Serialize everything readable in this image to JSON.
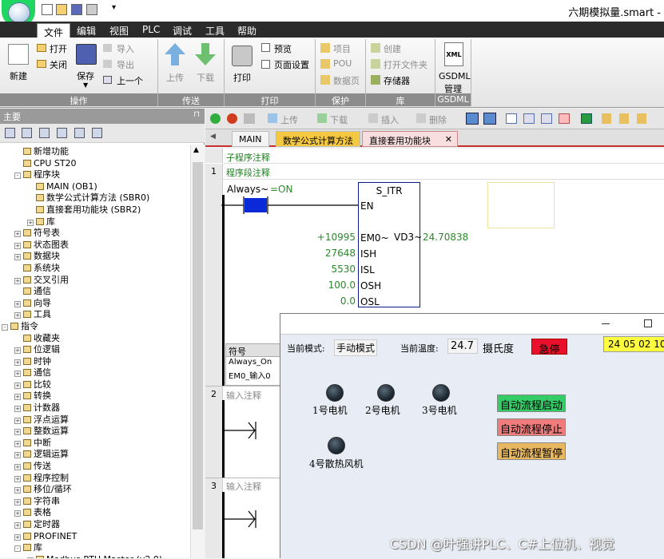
{
  "window": {
    "title": "六期模拟量.smart -"
  },
  "quick_access": {
    "arrow": "▾"
  },
  "menu": [
    "文件",
    "编辑",
    "视图",
    "PLC",
    "调试",
    "工具",
    "帮助"
  ],
  "ribbon": {
    "groups": [
      {
        "label": "操作",
        "items": [
          "新建",
          "打开",
          "关闭",
          "保存",
          "导入",
          "导出",
          "上一个"
        ]
      },
      {
        "label": "传送",
        "items": [
          "上传",
          "下载"
        ]
      },
      {
        "label": "打印",
        "items": [
          "打印",
          "预览",
          "页面设置"
        ]
      },
      {
        "label": "保护",
        "items": [
          "项目",
          "POU",
          "数据页"
        ]
      },
      {
        "label": "库",
        "items": [
          "创建",
          "打开文件夹",
          "存储器"
        ]
      },
      {
        "label": "GSDML",
        "items": [
          "GSDML",
          "管理"
        ]
      }
    ],
    "gsdml_icon_text": "XML"
  },
  "left_panel": {
    "title": "主要",
    "pin": "⊓",
    "tree": [
      {
        "text": "新增功能",
        "indent": 1
      },
      {
        "text": "CPU ST20",
        "indent": 1
      },
      {
        "text": "程序块",
        "indent": 1,
        "pm": "-"
      },
      {
        "text": "MAIN (OB1)",
        "indent": 2
      },
      {
        "text": "数学公式计算方法 (SBR0)",
        "indent": 2
      },
      {
        "text": "直接套用功能块 (SBR2)",
        "indent": 2
      },
      {
        "text": "库",
        "indent": 2,
        "pm": "+"
      },
      {
        "text": "符号表",
        "indent": 1,
        "pm": "+"
      },
      {
        "text": "状态图表",
        "indent": 1,
        "pm": "+"
      },
      {
        "text": "数据块",
        "indent": 1,
        "pm": "+"
      },
      {
        "text": "系统块",
        "indent": 1
      },
      {
        "text": "交叉引用",
        "indent": 1,
        "pm": "+"
      },
      {
        "text": "通信",
        "indent": 1
      },
      {
        "text": "向导",
        "indent": 1,
        "pm": "+"
      },
      {
        "text": "工具",
        "indent": 1,
        "pm": "+"
      },
      {
        "text": "指令",
        "indent": 0,
        "pm": "-"
      },
      {
        "text": "收藏夹",
        "indent": 1
      },
      {
        "text": "位逻辑",
        "indent": 1,
        "pm": "+"
      },
      {
        "text": "时钟",
        "indent": 1,
        "pm": "+"
      },
      {
        "text": "通信",
        "indent": 1,
        "pm": "+"
      },
      {
        "text": "比较",
        "indent": 1,
        "pm": "+"
      },
      {
        "text": "转换",
        "indent": 1,
        "pm": "+"
      },
      {
        "text": "计数器",
        "indent": 1,
        "pm": "+"
      },
      {
        "text": "浮点运算",
        "indent": 1,
        "pm": "+"
      },
      {
        "text": "整数运算",
        "indent": 1,
        "pm": "+"
      },
      {
        "text": "中断",
        "indent": 1,
        "pm": "+"
      },
      {
        "text": "逻辑运算",
        "indent": 1,
        "pm": "+"
      },
      {
        "text": "传送",
        "indent": 1,
        "pm": "+"
      },
      {
        "text": "程序控制",
        "indent": 1,
        "pm": "+"
      },
      {
        "text": "移位/循环",
        "indent": 1,
        "pm": "+"
      },
      {
        "text": "字符串",
        "indent": 1,
        "pm": "+"
      },
      {
        "text": "表格",
        "indent": 1,
        "pm": "+"
      },
      {
        "text": "定时器",
        "indent": 1,
        "pm": "+"
      },
      {
        "text": "PROFINET",
        "indent": 1,
        "pm": "+"
      },
      {
        "text": "库",
        "indent": 1,
        "pm": "-"
      },
      {
        "text": "Modbus RTU Master (v2.0)",
        "indent": 2,
        "pm": "+"
      }
    ]
  },
  "editor_toolbar": {
    "upload": "上传",
    "download": "下载",
    "insert": "插入",
    "delete": "删除"
  },
  "tabs": [
    "MAIN",
    "数学公式计算方法",
    "直接套用功能块"
  ],
  "tab_close": "✕",
  "editor": {
    "subroutine_comment": "子程序注释",
    "network1": {
      "num": "1",
      "comment": "程序段注释",
      "contact": "Always~",
      "contact_state": "=ON"
    },
    "block": {
      "name": "S_ITR",
      "en": "EN",
      "inputs": [
        {
          "value": "+10995",
          "pin": "EM0~"
        },
        {
          "value": "27648",
          "pin": "ISH"
        },
        {
          "value": "5530",
          "pin": "ISL"
        },
        {
          "value": "100.0",
          "pin": "OSH"
        },
        {
          "value": "0.0",
          "pin": "OSL"
        }
      ],
      "output_pin": "VD3~",
      "output_value": "24.70838"
    },
    "symbol_table": {
      "header": "符号",
      "rows": [
        "Always_On",
        "EM0_输入0"
      ]
    },
    "network2": {
      "num": "2",
      "comment": "输入注释"
    },
    "network3": {
      "num": "3",
      "comment": "输入注释"
    }
  },
  "hmi": {
    "mode_label": "当前模式:",
    "mode_value": "手动模式",
    "temp_label": "当前温度:",
    "temp_value": "24.7",
    "temp_unit": "摄氏度",
    "estop": "急停",
    "datetime": "24 05 02 10",
    "motors": [
      "1号电机",
      "2号电机",
      "3号电机",
      "4号散热风机"
    ],
    "buttons": {
      "start": "自动流程启动",
      "stop": "自动流程停止",
      "pause": "自动流程暂停"
    },
    "colors": {
      "start": "#33cc66",
      "stop": "#f07c7c",
      "pause": "#e8b860",
      "estop": "#e8102a",
      "datetime": "#ffff40"
    }
  },
  "watermark": "CSDN @叶强讲PLC、C#上位机、视觉"
}
